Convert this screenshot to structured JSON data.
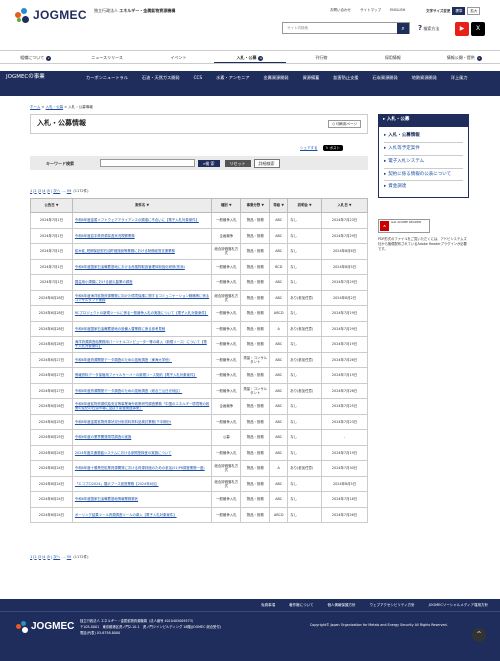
{
  "header": {
    "logo_text": "JOGMEC",
    "org_prefix": "独立行政法人",
    "org_name": "エネルギー・金属鉱物資源機構",
    "links": [
      "お問い合わせ",
      "サイトマップ",
      "ENGLISH"
    ],
    "font_size_label": "文字サイズ変更",
    "font_size_options": [
      "標準",
      "拡大"
    ],
    "search_placeholder": "サイト内検索",
    "search_help": "検索方法"
  },
  "global_nav": [
    "組織について",
    "ニュースリリース",
    "イベント",
    "入札・公募",
    "刊行物",
    "採用情報",
    "情報公開・提供"
  ],
  "sub_nav": {
    "title": "JOGMECの事業",
    "items": [
      "カーボンニュートラル",
      "石油・天然ガス開発",
      "CCS",
      "水素・アンモニア",
      "金属資源開発",
      "資源備蓄",
      "鉱害防止支援",
      "石炭資源開発",
      "地熱資源開発",
      "洋上風力"
    ]
  },
  "breadcrumb": [
    "ホーム",
    "入札・公募",
    "入札・公募情報"
  ],
  "main": {
    "title": "入札・公募情報",
    "print_label": "印刷用ページ",
    "share_label": "シェアする",
    "post_label": "ポスト",
    "keyword_label": "キーワード検索",
    "search_button": "検 索",
    "reset_button": "リセット",
    "advanced_button": "詳細検索"
  },
  "pager": {
    "pages": [
      "1",
      "2",
      "3",
      "4",
      "5"
    ],
    "next": "次へ",
    "last": "59",
    "total": "(1172件)"
  },
  "table": {
    "headers": [
      "公告日",
      "案件名",
      "種別",
      "事業分野",
      "等級",
      "説明会",
      "入札日"
    ],
    "rows": [
      {
        "date": "2024年7月1日",
        "name": "令和6年度金属ソフトウェアアライアンスの調達に不合いに【電子入札対象案件】",
        "kind": "一般競争入札",
        "field": "物品・役務",
        "grade": "ABC",
        "brief": "なし",
        "bid": "2024年7月23日"
      },
      {
        "date": "2024年7月1日",
        "name": "令和6年度岩手県資源探査状況視察業務",
        "kind": "企画競争",
        "field": "物品・役務",
        "grade": "ABC",
        "brief": "なし",
        "bid": "2024年7月29日"
      },
      {
        "date": "2024年7月1日",
        "name": "鉱木鉱_短期保証型石油貯蔵施設等業務における財務経営支援業務",
        "kind": "総合評価落札方式",
        "field": "物品・役務",
        "grade": "ABC",
        "brief": "なし",
        "bid": "2024年8月6日"
      },
      {
        "date": "2024年7月1日",
        "name": "令和6年度国家石油備蓄基地における危険物取扱管理体制強化研修(別添)",
        "kind": "一般競争入札",
        "field": "物品・役務",
        "grade": "BCD",
        "brief": "なし",
        "bid": "2024年8月5日"
      },
      {
        "date": "2024年7月1日",
        "name": "国益用小規模における被災農業の調査",
        "kind": "一般競争入札",
        "field": "物品・役務",
        "grade": "ABC",
        "brief": "なし",
        "bid": "2024年7月29日"
      },
      {
        "date": "2024年6月28日",
        "name": "令和6年度海洋鉱物資源開発に向けた環境保護に関するコミュニケーション戦略等に係るコンサルタント業務",
        "kind": "総合評価落札方式",
        "field": "物品・役務",
        "grade": "ABC",
        "brief": "あり(参加任意)",
        "bid": "2024年8月2日"
      },
      {
        "date": "2024年6月28日",
        "name": "RCプロジェクトの新規ツールに係る一般競争入札の実施について【電子入札対象案件】",
        "kind": "一般競争入札",
        "field": "物品・役務",
        "grade": "ABCD",
        "brief": "なし",
        "bid": "2024年7月19日"
      },
      {
        "date": "2024年6月28日",
        "name": "令和6年度国家石油備蓄基地の設備入替業務に係る参考見積",
        "kind": "一般競争入札",
        "field": "物品・役務",
        "grade": "A",
        "brief": "あり(参加任意)",
        "bid": "2024年7月29日"
      },
      {
        "date": "2024年6月28日",
        "name": "海洋資源調査船業務用パーソナルコンピューター等の導入（新規リース）について【電子入札対象案件】",
        "kind": "一般競争入札",
        "field": "物品・役務",
        "grade": "ABC",
        "brief": "なし",
        "bid": "2024年7月19日"
      },
      {
        "date": "2024年6月27日",
        "name": "令和6年度資源開発データ調査のための技術調査（東海大学他）",
        "kind": "一般競争入札",
        "field": "測量・コンサルタント",
        "grade": "ABC",
        "brief": "あり(参加任意)",
        "bid": "2024年7月26日"
      },
      {
        "date": "2024年6月27日",
        "name": "情報資料データ保管用ファイルサーバーの新規リース契約【電子入札対象案件】",
        "kind": "一般競争入札",
        "field": "物品・役務",
        "grade": "ABC",
        "brief": "なし",
        "bid": "2024年7月19日"
      },
      {
        "date": "2024年6月27日",
        "name": "令和6年度資源開発データ調査のための技術調査（総合三山日光地区）",
        "kind": "一般競争入札",
        "field": "測量・コンサルタント",
        "grade": "ABC",
        "brief": "あり(参加任意)",
        "bid": "2024年7月26日"
      },
      {
        "date": "2024年6月26日",
        "name": "令和6年度鉱物資源供給安定等事業海外政策研究調査業務「中国のエネルギー環境等の政策の変化の石油市場に及ぼす影響関連事業」",
        "kind": "企画競争",
        "field": "物品・役務",
        "grade": "ABC",
        "brief": "なし",
        "bid": "2024年7月25日"
      },
      {
        "date": "2024年6月25日",
        "name": "令和6年度金属鉱物資源状況分析試料資料品検討業務(下半期分)",
        "kind": "一般競争入札",
        "field": "物品・役務",
        "grade": "ABC",
        "brief": "なし",
        "bid": "2024年7月23日"
      },
      {
        "date": "2024年6月25日",
        "name": "令和6年度の業界開発環境調査の実施",
        "kind": "公募",
        "field": "物品・役務",
        "grade": "ABC",
        "brief": "なし",
        "bid": "-"
      },
      {
        "date": "2024年6月24日",
        "name": "2024年度共通基盤システムにおける参照型検査の実施について",
        "kind": "一般競争入札",
        "field": "物品・役務",
        "grade": "ABC",
        "brief": "なし",
        "bid": "2024年7月19日"
      },
      {
        "date": "2024年6月24日",
        "name": "令和6年度十勝黒岳鉱業資源開発における資源評価のための参加(S1/P6調査業務一連)",
        "kind": "総合評価落札方式",
        "field": "物品・役務",
        "grade": "A",
        "brief": "あり(参加任意)",
        "bid": "2024年7月30日"
      },
      {
        "date": "2024年6月24日",
        "name": "「エコプロ2024」展示ブース設営業務【2024年6月】",
        "kind": "総合評価落札方式",
        "field": "物品・役務",
        "grade": "ABC",
        "brief": "なし",
        "bid": "2024年8月5日"
      },
      {
        "date": "2024年6月24日",
        "name": "令和6年度国家石油備蓄基地情報業務委託",
        "kind": "一般競争入札",
        "field": "物品・役務",
        "grade": "ABC",
        "brief": "なし",
        "bid": "2024年7月18日"
      },
      {
        "date": "2024年6月24日",
        "name": "ボーリング結果ツール資源調査ツールの導入【電子入札対象案件】",
        "kind": "一般競争入札",
        "field": "物品・役務",
        "grade": "ABCD",
        "brief": "なし",
        "bid": "2024年7月26日"
      }
    ]
  },
  "sidebar": {
    "title": "入札・公募",
    "items": [
      "入札・公募情報",
      "入札等予定案件",
      "電子入札システム",
      "契約に係る情報の公表について",
      "資金調達"
    ],
    "adobe_label": "Get ADOBE READER",
    "adobe_note": "PDF形式のファイルをご覧いただくには、アドビシステムズ社から無償配布されているAdobe Readerプラグインが必要です。"
  },
  "footer": {
    "links": [
      "免責事項",
      "著作権について",
      "個人情報保護方針",
      "ウェブアクセシビリティ方針",
      "JOGMECソーシャルメディア運用方針"
    ],
    "logo_text": "JOGMEC",
    "address_line1": "独立行政法人 エネルギー・金属鉱物資源機構（法人番号 4010405009573）",
    "address_line2": "〒105-0001　東京都港区虎ノ門2-10-1　虎ノ門ツインビルディング 16階(JOGMEC 総合受付)",
    "address_line3": "電話(代表) 03-6758-8000",
    "copyright": "Copyright© Japan Organization for Metals and Energy Security All Rights Reserved."
  }
}
